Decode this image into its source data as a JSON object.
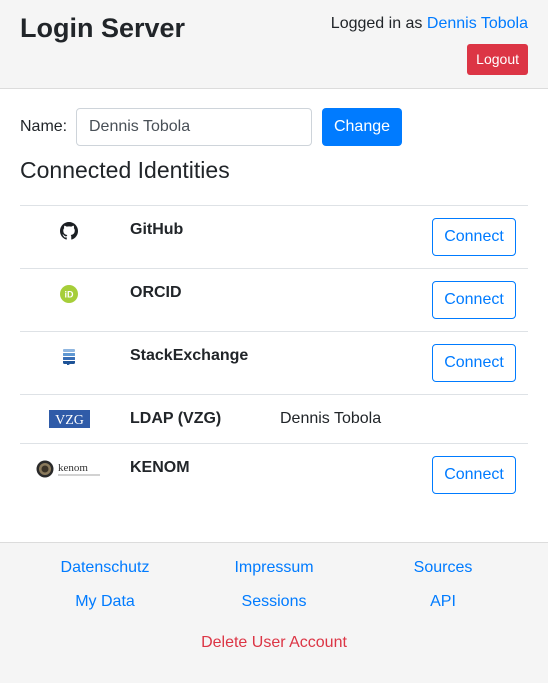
{
  "header": {
    "title": "Login Server",
    "logged_in_prefix": "Logged in as",
    "user_name": "Dennis Tobola",
    "logout_label": "Logout"
  },
  "name_form": {
    "label": "Name:",
    "value": "Dennis Tobola",
    "change_label": "Change"
  },
  "identities": {
    "title": "Connected Identities",
    "items": [
      {
        "name": "GitHub",
        "value": "",
        "action": "Connect",
        "icon": "github-icon"
      },
      {
        "name": "ORCID",
        "value": "",
        "action": "Connect",
        "icon": "orcid-icon"
      },
      {
        "name": "StackExchange",
        "value": "",
        "action": "Connect",
        "icon": "stackexchange-icon"
      },
      {
        "name": "LDAP (VZG)",
        "value": "Dennis Tobola",
        "action": "",
        "icon": "vzg-logo",
        "logo_text": "VZG"
      },
      {
        "name": "KENOM",
        "value": "",
        "action": "Connect",
        "icon": "kenom-logo",
        "logo_text": "kenom"
      }
    ]
  },
  "footer": {
    "links": [
      "Datenschutz",
      "Impressum",
      "Sources",
      "My Data",
      "Sessions",
      "API"
    ],
    "delete_account": "Delete User Account"
  },
  "colors": {
    "primary": "#007bff",
    "danger": "#dc3545",
    "orcid": "#a6ce39",
    "vzg": "#2f5ba8"
  }
}
